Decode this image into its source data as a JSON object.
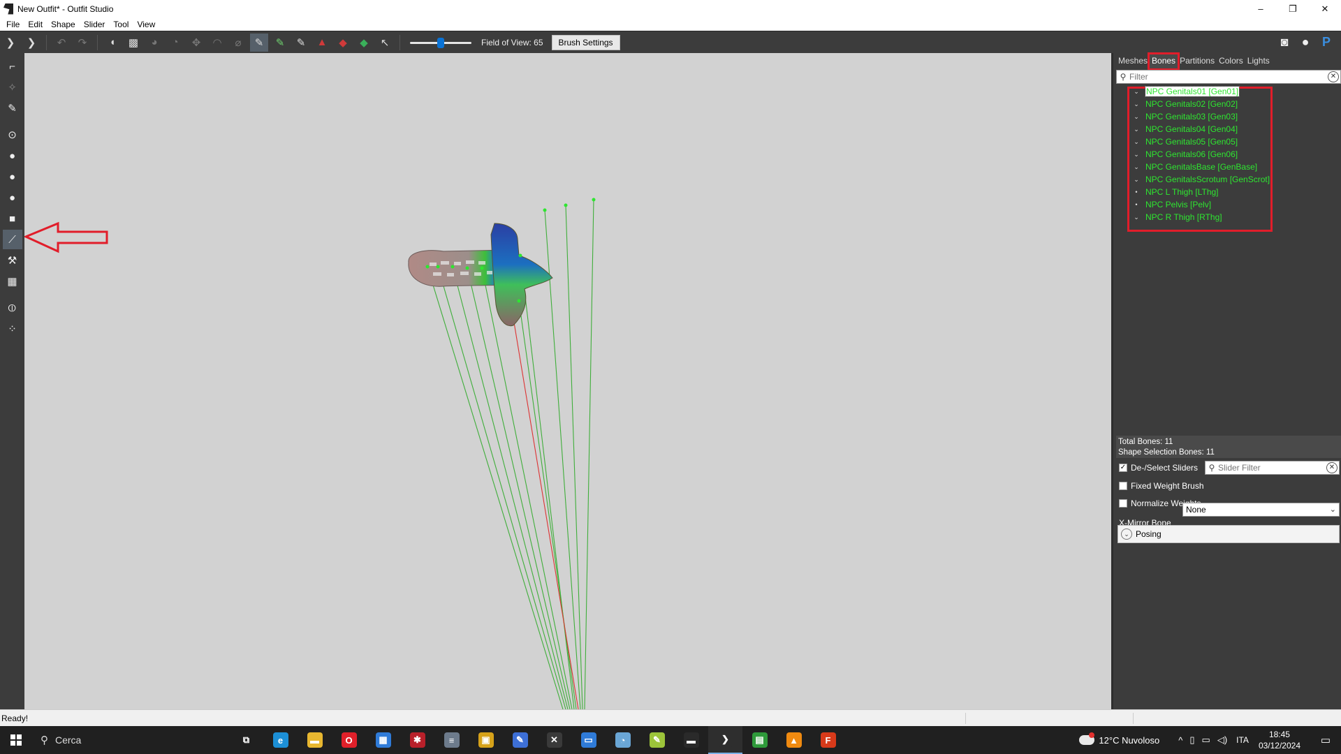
{
  "window": {
    "title": "New Outfit* - Outfit Studio",
    "controls": {
      "minimize": "–",
      "maximize": "❐",
      "close": "✕"
    }
  },
  "menu": [
    "File",
    "Edit",
    "Shape",
    "Slider",
    "Tool",
    "View"
  ],
  "toolbar": {
    "fov_label": "Field of View: 65",
    "fov_value": 65,
    "brush_settings": "Brush Settings",
    "icons_left": [
      "outfit-studio-logo-icon",
      "bodyslide-logo-icon",
      "undo-icon",
      "redo-icon",
      "select-brush-icon",
      "mask-brush-icon",
      "inflate-brush-icon",
      "deflate-brush-icon",
      "move-brush-icon",
      "smooth-brush-icon",
      "undiff-brush-icon",
      "weight-brush-icon",
      "color-brush-icon",
      "alpha-brush-icon",
      "collapse-vertex-icon",
      "flip-edge-icon",
      "split-edge-icon",
      "pointer-icon"
    ],
    "icons_right": [
      "discord-icon",
      "github-icon",
      "paypal-icon"
    ]
  },
  "left_tools": [
    "transform-icon",
    "pivot-icon",
    "pencil-icon",
    "vertex-select-icon",
    "sphere-large-icon",
    "sphere-medium-icon",
    "sphere-small-icon",
    "cube-icon",
    "bones-icon",
    "weight-icon",
    "wireframe-grid-icon",
    "mirror-icon",
    "connect-icon"
  ],
  "right_panel": {
    "tabs": [
      "Meshes",
      "Bones",
      "Partitions",
      "Colors",
      "Lights"
    ],
    "active_tab": "Bones",
    "filter_placeholder": "Filter",
    "bones": [
      {
        "label": "NPC Genitals01 [Gen01]",
        "expandable": true,
        "selected": true
      },
      {
        "label": "NPC Genitals02 [Gen02]",
        "expandable": true
      },
      {
        "label": "NPC Genitals03 [Gen03]",
        "expandable": true
      },
      {
        "label": "NPC Genitals04 [Gen04]",
        "expandable": true
      },
      {
        "label": "NPC Genitals05 [Gen05]",
        "expandable": true
      },
      {
        "label": "NPC Genitals06 [Gen06]",
        "expandable": true
      },
      {
        "label": "NPC GenitalsBase [GenBase]",
        "expandable": true
      },
      {
        "label": "NPC GenitalsScrotum [GenScrot]",
        "expandable": true
      },
      {
        "label": "NPC L Thigh [LThg]",
        "expandable": false
      },
      {
        "label": "NPC Pelvis [Pelv]",
        "expandable": false
      },
      {
        "label": "NPC R Thigh [RThg]",
        "expandable": true
      }
    ],
    "total_bones": "Total Bones: 11",
    "shape_selection_bones": "Shape Selection Bones: 11",
    "options": {
      "deselect_sliders": {
        "label": "De-/Select Sliders",
        "checked": true
      },
      "slider_filter_placeholder": "Slider Filter",
      "fixed_weight_brush": {
        "label": "Fixed Weight Brush",
        "checked": false
      },
      "normalize_weights": {
        "label": "Normalize Weights",
        "checked": false
      },
      "xmirror_label": "X-Mirror Bone",
      "xmirror_value": "None",
      "posing_label": "Posing"
    }
  },
  "status": "Ready!",
  "taskbar": {
    "search_label": "Cerca",
    "apps": [
      {
        "name": "task-view-icon",
        "color": "#202020",
        "glyph": "⧉"
      },
      {
        "name": "edge-icon",
        "color": "#1c8fd6",
        "glyph": "e"
      },
      {
        "name": "file-explorer-icon",
        "color": "#e8b730",
        "glyph": "▬"
      },
      {
        "name": "opera-icon",
        "color": "#e0202a",
        "glyph": "O"
      },
      {
        "name": "store-icon",
        "color": "#2f7bd8",
        "glyph": "▦"
      },
      {
        "name": "app-red-icon",
        "color": "#b8202a",
        "glyph": "✱"
      },
      {
        "name": "app-notepad-icon",
        "color": "#6d7b8c",
        "glyph": "≡"
      },
      {
        "name": "app-yellow-icon",
        "color": "#d6a21a",
        "glyph": "▣"
      },
      {
        "name": "app-feather-icon",
        "color": "#3d6fd6",
        "glyph": "✎"
      },
      {
        "name": "app-xedit-icon",
        "color": "#3a3a3a",
        "glyph": "✕"
      },
      {
        "name": "app-blue-icon",
        "color": "#2f7bd8",
        "glyph": "▭"
      },
      {
        "name": "app-paint-icon",
        "color": "#6aa6d6",
        "glyph": "◔"
      },
      {
        "name": "app-notepadpp-icon",
        "color": "#9cc43a",
        "glyph": "✎"
      },
      {
        "name": "app-terminal-icon",
        "color": "#2a2a2a",
        "glyph": "▬"
      },
      {
        "name": "outfit-studio-task-icon",
        "color": "#2e2e2e",
        "glyph": "❯",
        "active": true
      },
      {
        "name": "app-green-icon",
        "color": "#2e9a3a",
        "glyph": "▤"
      },
      {
        "name": "vlc-icon",
        "color": "#f08a10",
        "glyph": "▲"
      },
      {
        "name": "app-f-icon",
        "color": "#d83a1a",
        "glyph": "F"
      }
    ],
    "weather": "12°C  Nuvoloso",
    "lang": "ITA",
    "time": "18:45",
    "date": "03/12/2024"
  },
  "colors": {
    "bone_text": "#2ee630",
    "highlight_red": "#e11d2a",
    "viewport_bg": "#d2d2d2",
    "panel_bg": "#3c3c3c"
  }
}
